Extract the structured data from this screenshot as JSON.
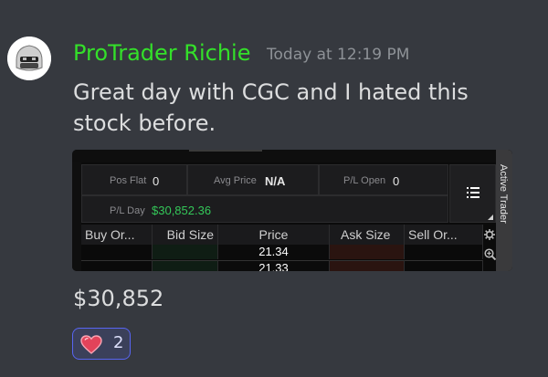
{
  "message": {
    "username": "ProTrader Richie",
    "timestamp": "Today at 12:19 PM",
    "text": "Great day with CGC and I hated this stock before.",
    "followup_text": "$30,852",
    "reaction": {
      "icon": "heart-emoji",
      "count": "2"
    }
  },
  "embed": {
    "panel": {
      "pos_flat_label": "Pos Flat",
      "pos_flat_value": "0",
      "avg_price_label": "Avg Price",
      "avg_price_value": "N/A",
      "pl_open_label": "P/L Open",
      "pl_open_value": "0",
      "pl_day_label": "P/L Day",
      "pl_day_value": "$30,852.36"
    },
    "sidebar_label": "Active Trader",
    "columns": [
      "Buy Or...",
      "Bid Size",
      "Price",
      "Ask Size",
      "Sell Or..."
    ],
    "prices": [
      "21.34",
      "21.33"
    ]
  },
  "colors": {
    "username": "#34e02a",
    "pl_day": "#34c759",
    "background": "#36393f"
  }
}
